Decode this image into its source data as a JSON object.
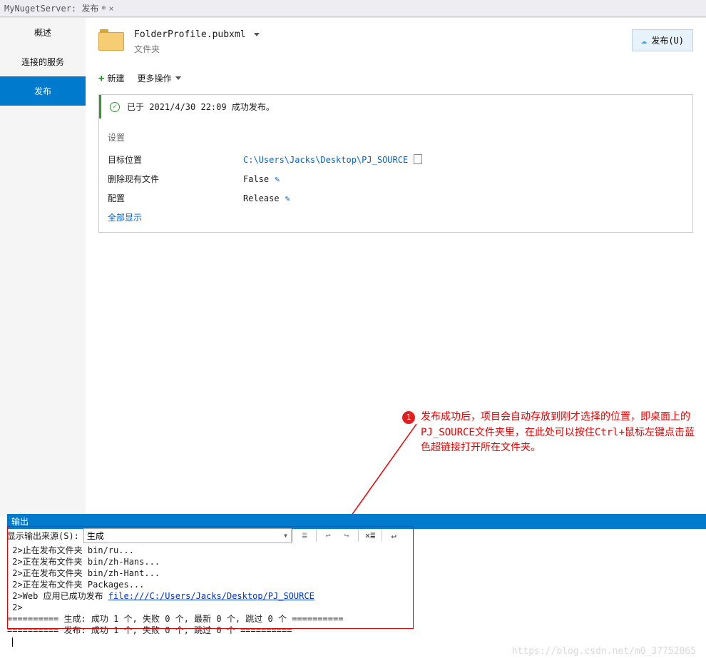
{
  "tab": {
    "title": "MyNugetServer: 发布"
  },
  "sidebar": {
    "items": [
      {
        "label": "概述"
      },
      {
        "label": "连接的服务"
      },
      {
        "label": "发布",
        "active": true
      }
    ]
  },
  "profile": {
    "name": "FolderProfile.pubxml",
    "type": "文件夹"
  },
  "publish_btn": "发布(U)",
  "toolbar": {
    "new": "新建",
    "more": "更多操作"
  },
  "status": {
    "text": "已于 2021/4/30 22:09 成功发布。"
  },
  "settings": {
    "title": "设置",
    "rows": [
      {
        "label": "目标位置",
        "value": "C:\\Users\\Jacks\\Desktop\\PJ_SOURCE",
        "link": true,
        "copy": true
      },
      {
        "label": "删除现有文件",
        "value": "False",
        "edit": true
      },
      {
        "label": "配置",
        "value": "Release",
        "edit": true
      }
    ],
    "show_all": "全部显示"
  },
  "annotation": {
    "badge": "1",
    "text": "发布成功后，项目会自动存放到刚才选择的位置，即桌面上的PJ_SOURCE文件夹里，在此处可以按住Ctrl+鼠标左键点击蓝色超链接打开所在文件夹。"
  },
  "output": {
    "panel_title": "输出",
    "source_label": "显示输出来源(S):",
    "source_value": "生成",
    "highlighted_link": "file:///C:/Users/Jacks/Desktop/PJ_SOURCE",
    "lines_pre": " 2>止在发布文件夹 bin/ru...\n 2>正在发布文件夹 bin/zh-Hans...\n 2>正在发布文件夹 bin/zh-Hant...\n 2>正在发布文件夹 Packages...\n 2>Web 应用已成功发布 ",
    "lines_post": "\n 2>\n========== 生成: 成功 1 个, 失败 0 个, 最新 0 个, 跳过 0 个 ==========\n========== 发布: 成功 1 个, 失败 0 个, 跳过 0 个 =========="
  },
  "watermark": "https://blog.csdn.net/m0_37752065"
}
